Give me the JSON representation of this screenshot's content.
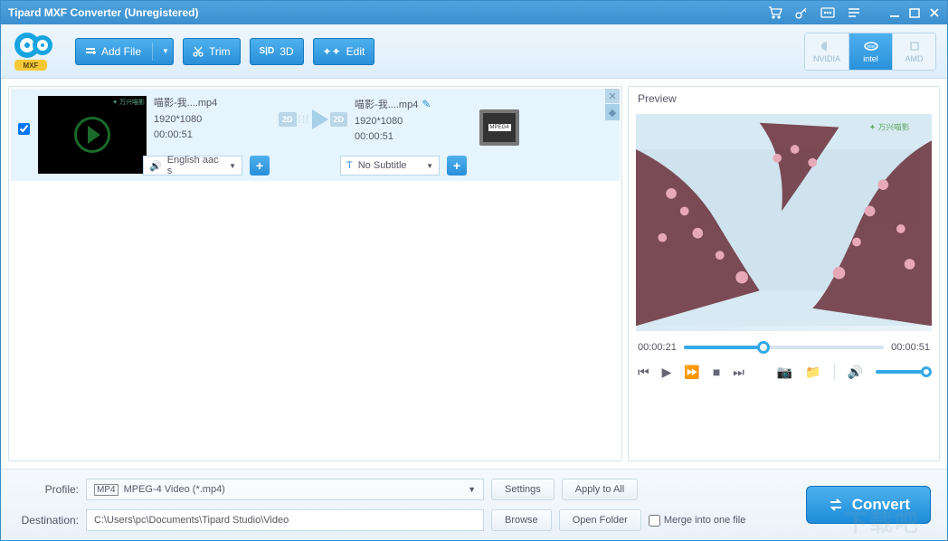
{
  "window": {
    "title": "Tipard MXF Converter (Unregistered)"
  },
  "toolbar": {
    "add_file": "Add File",
    "trim": "Trim",
    "three_d": "3D",
    "edit": "Edit"
  },
  "gpu": {
    "nvidia": "NVIDIA",
    "intel": "intel",
    "amd": "AMD"
  },
  "file": {
    "in_name": "喵影-我....mp4",
    "in_res": "1920*1080",
    "in_dur": "00:00:51",
    "out_name": "喵影-我....mp4",
    "out_res": "1920*1080",
    "out_dur": "00:00:51",
    "audio": "English aac s",
    "subtitle": "No Subtitle",
    "badge_2d": "2D",
    "format_badge": "MPEG4"
  },
  "preview": {
    "title": "Preview",
    "current": "00:00:21",
    "total": "00:00:51"
  },
  "bottom": {
    "profile_label": "Profile:",
    "profile_value": "MPEG-4 Video (*.mp4)",
    "settings": "Settings",
    "apply_all": "Apply to All",
    "dest_label": "Destination:",
    "dest_value": "C:\\Users\\pc\\Documents\\Tipard Studio\\Video",
    "browse": "Browse",
    "open_folder": "Open Folder",
    "merge": "Merge into one file",
    "convert": "Convert"
  },
  "watermark": "下载吧"
}
